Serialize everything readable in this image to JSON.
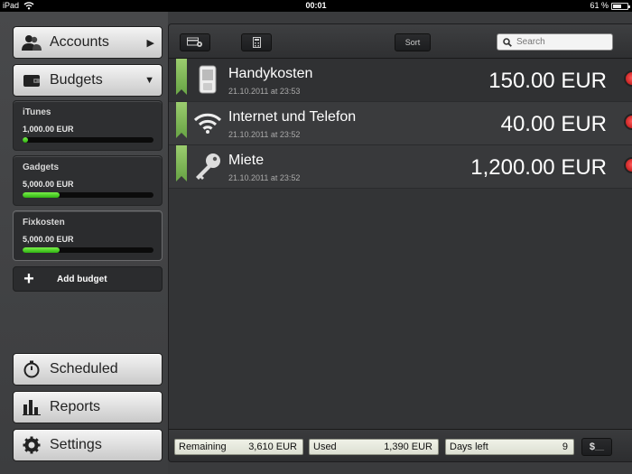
{
  "statusbar": {
    "device": "iPad",
    "time": "00:01",
    "battery": "61 %",
    "battery_level": 0.61
  },
  "sidebar": {
    "accounts_label": "Accounts",
    "budgets_label": "Budgets",
    "budgets": [
      {
        "name": "iTunes",
        "amount": "1,000.00 EUR",
        "used_fraction": 0.04
      },
      {
        "name": "Gadgets",
        "amount": "5,000.00 EUR",
        "used_fraction": 0.28
      },
      {
        "name": "Fixkosten",
        "amount": "5,000.00 EUR",
        "used_fraction": 0.28
      }
    ],
    "add_budget_label": "Add budget",
    "scheduled_label": "Scheduled",
    "reports_label": "Reports",
    "settings_label": "Settings"
  },
  "toolbar": {
    "sort_label": "Sort",
    "search_placeholder": "Search"
  },
  "transactions": [
    {
      "title": "Handykosten",
      "date": "21.10.2011 at 23:53",
      "amount": "150.00 EUR",
      "icon": "phone-icon"
    },
    {
      "title": "Internet und Telefon",
      "date": "21.10.2011 at 23:52",
      "amount": "40.00 EUR",
      "icon": "wifi-icon"
    },
    {
      "title": "Miete",
      "date": "21.10.2011 at 23:52",
      "amount": "1,200.00 EUR",
      "icon": "key-icon"
    }
  ],
  "footer": {
    "remaining_label": "Remaining",
    "remaining_value": "3,610 EUR",
    "used_label": "Used",
    "used_value": "1,390 EUR",
    "days_left_label": "Days left",
    "days_left_value": "9"
  },
  "colors": {
    "accent_green": "#6ea94a",
    "progress_green": "#2fb312",
    "delete_red": "#b20d0d"
  }
}
